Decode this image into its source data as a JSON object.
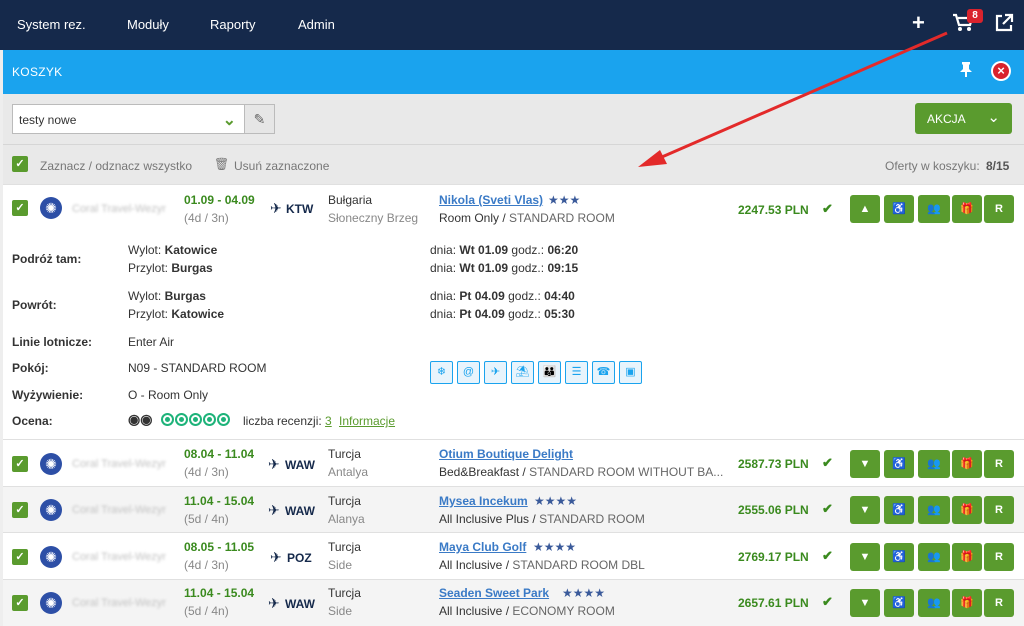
{
  "nav": [
    "System rez.",
    "Moduły",
    "Raporty",
    "Admin"
  ],
  "cart": {
    "badge": "8"
  },
  "panel": {
    "title": "KOSZYK"
  },
  "toolbar": {
    "basket_value": "testy nowe",
    "action_label": "AKCJA",
    "select_all": "Zaznacz / odznacz wszystko",
    "delete_selected": "Usuń zaznaczone",
    "offers_label": "Oferty w koszyku:",
    "offers_count": "8/15"
  },
  "offers": [
    {
      "operator": "Coral Travel-Wezyr",
      "dates": "01.09 - 04.09",
      "duration": "(4d / 3n)",
      "airport": "KTW",
      "country": "Bułgaria",
      "region": "Słoneczny Brzeg",
      "hotel": "Nikola (Sveti Vlas)",
      "stars": "★★★",
      "board": "Room Only",
      "room": "STANDARD ROOM",
      "price": "2247.53 PLN"
    },
    {
      "operator": "Coral Travel-Wezyr",
      "dates": "08.04 - 11.04",
      "duration": "(4d / 3n)",
      "airport": "WAW",
      "country": "Turcja",
      "region": "Antalya",
      "hotel": "Otium Boutique Delight",
      "stars": "",
      "board": "Bed&Breakfast",
      "room": "STANDARD ROOM WITHOUT BA...",
      "price": "2587.73 PLN"
    },
    {
      "operator": "Coral Travel-Wezyr",
      "dates": "11.04 - 15.04",
      "duration": "(5d / 4n)",
      "airport": "WAW",
      "country": "Turcja",
      "region": "Alanya",
      "hotel": "Mysea Incekum",
      "stars": "★★★★",
      "board": "All Inclusive Plus",
      "room": "STANDARD ROOM",
      "price": "2555.06 PLN"
    },
    {
      "operator": "Coral Travel-Wezyr",
      "dates": "08.05 - 11.05",
      "duration": "(4d / 3n)",
      "airport": "POZ",
      "country": "Turcja",
      "region": "Side",
      "hotel": "Maya Club Golf",
      "stars": "★★★★",
      "board": "All Inclusive",
      "room": "STANDARD ROOM DBL",
      "price": "2769.17 PLN"
    },
    {
      "operator": "Coral Travel-Wezyr",
      "dates": "11.04 - 15.04",
      "duration": "(5d / 4n)",
      "airport": "WAW",
      "country": "Turcja",
      "region": "Side",
      "hotel": "Seaden Sweet Park",
      "stars": "★★★★",
      "board": "All Inclusive",
      "room": "ECONOMY ROOM",
      "price": "2657.61 PLN"
    }
  ],
  "details": {
    "outbound_label": "Podróż tam:",
    "return_label": "Powrót:",
    "dep_prefix": "Wylot:",
    "arr_prefix": "Przylot:",
    "day_prefix": "dnia:",
    "time_prefix": "godz.:",
    "out_dep_city": "Katowice",
    "out_arr_city": "Burgas",
    "out_dep_day": "Wt 01.09",
    "out_dep_time": "06:20",
    "out_arr_day": "Wt 01.09",
    "out_arr_time": "09:15",
    "ret_dep_city": "Burgas",
    "ret_arr_city": "Katowice",
    "ret_dep_day": "Pt 04.09",
    "ret_dep_time": "04:40",
    "ret_arr_day": "Pt 04.09",
    "ret_arr_time": "05:30",
    "airlines_label": "Linie lotnicze:",
    "airlines": "Enter Air",
    "room_label": "Pokój:",
    "room": "N09 - STANDARD ROOM",
    "board_label": "Wyżywienie:",
    "board": "O - Room Only",
    "rating_label": "Ocena:",
    "reviews_label": "liczba recenzji:",
    "reviews_count": "3",
    "info_link": "Informacje",
    "amenities": [
      "ac-icon",
      "internet-icon",
      "airport-transfer-icon",
      "beach-icon",
      "family-icon",
      "elevator-icon",
      "phone-icon",
      "safe-icon"
    ]
  },
  "colors": {
    "nav": "#15294b",
    "header": "#1aa3ee",
    "green": "#5a9b2e",
    "price": "#3a8a1e",
    "arrow": "#e32a2a"
  }
}
